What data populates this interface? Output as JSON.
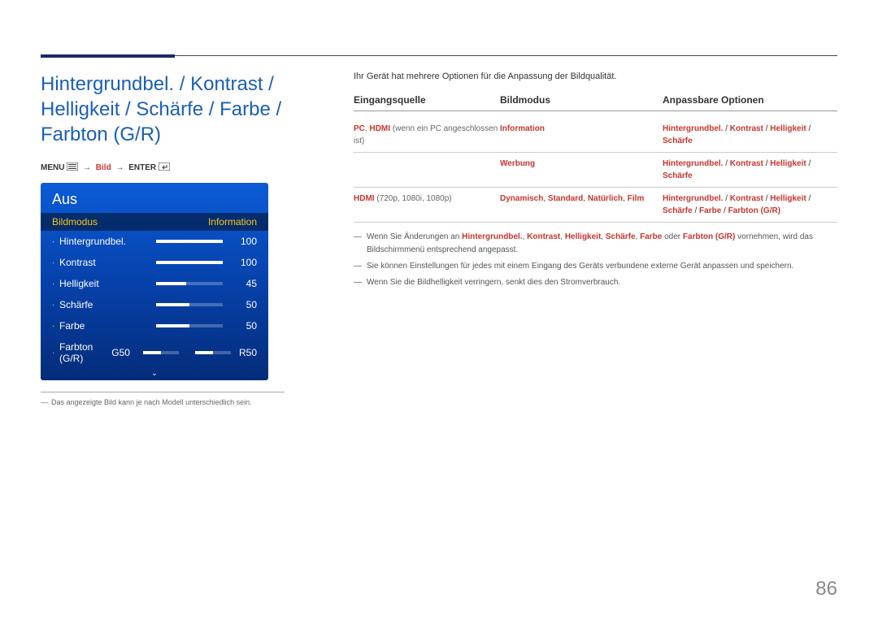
{
  "page_number": "86",
  "title": "Hintergrundbel. / Kontrast / Helligkeit / Schärfe / Farbe / Farbton (G/R)",
  "menu_path": {
    "menu": "MENU",
    "arrow": "→",
    "bild": "Bild",
    "enter": "ENTER"
  },
  "osd": {
    "title": "Aus",
    "header_left": "Bildmodus",
    "header_right": "Information",
    "rows": [
      {
        "name": "Hintergrundbel.",
        "value": "100",
        "fill": 100
      },
      {
        "name": "Kontrast",
        "value": "100",
        "fill": 100
      },
      {
        "name": "Helligkeit",
        "value": "45",
        "fill": 45
      },
      {
        "name": "Schärfe",
        "value": "50",
        "fill": 50
      },
      {
        "name": "Farbe",
        "value": "50",
        "fill": 50
      }
    ],
    "farbton": {
      "name": "Farbton (G/R)",
      "g_label": "G50",
      "r_label": "R50"
    }
  },
  "footnote": "Das angezeigte Bild kann je nach Modell unterschiedlich sein.",
  "intro": "Ihr Gerät hat mehrere Optionen für die Anpassung der Bildqualität.",
  "table": {
    "headers": {
      "a": "Eingangsquelle",
      "b": "Bildmodus",
      "c": "Anpassbare Optionen"
    },
    "r1": {
      "a_bold": "PC",
      "a_sep1": ", ",
      "a_bold2": "HDMI",
      "a_rest": " (wenn ein PC angeschlossen ist)",
      "b": "Information",
      "c_parts": {
        "p1": "Hintergrundbel.",
        "s": " / ",
        "p2": "Kontrast",
        "p3": "Helligkeit",
        "p4": "Schärfe"
      }
    },
    "r2": {
      "b": "Werbung",
      "c_parts": {
        "p1": "Hintergrundbel.",
        "s": " / ",
        "p2": "Kontrast",
        "p3": "Helligkeit",
        "p4": "Schärfe"
      }
    },
    "r3": {
      "a_bold": "HDMI",
      "a_rest": " (720p, 1080i, 1080p)",
      "b_parts": {
        "p1": "Dynamisch",
        "s": ", ",
        "p2": "Standard",
        "p3": "Natürlich",
        "p4": "Film"
      },
      "c_parts": {
        "p1": "Hintergrundbel.",
        "s": " / ",
        "p2": "Kontrast",
        "p3": "Helligkeit",
        "p4": "Schärfe",
        "p5": "Farbe",
        "p6": "Farbton (G/R)"
      }
    }
  },
  "bullets": {
    "b1_pre": "Wenn Sie Änderungen an ",
    "b1_h": "Hintergrundbel.",
    "b1_sep": ", ",
    "b1_k": "Kontrast",
    "b1_he": "Helligkeit",
    "b1_s": "Schärfe",
    "b1_f": "Farbe",
    "b1_o": " oder ",
    "b1_fb": "Farbton (G/R)",
    "b1_post": " vornehmen, wird das Bildschirmmenü entsprechend angepasst.",
    "b2": "Sie können Einstellungen für jedes mit einem Eingang des Geräts verbundene externe Gerät anpassen und speichern.",
    "b3": "Wenn Sie die Bildhelligkeit verringern, senkt dies den Stromverbrauch."
  }
}
